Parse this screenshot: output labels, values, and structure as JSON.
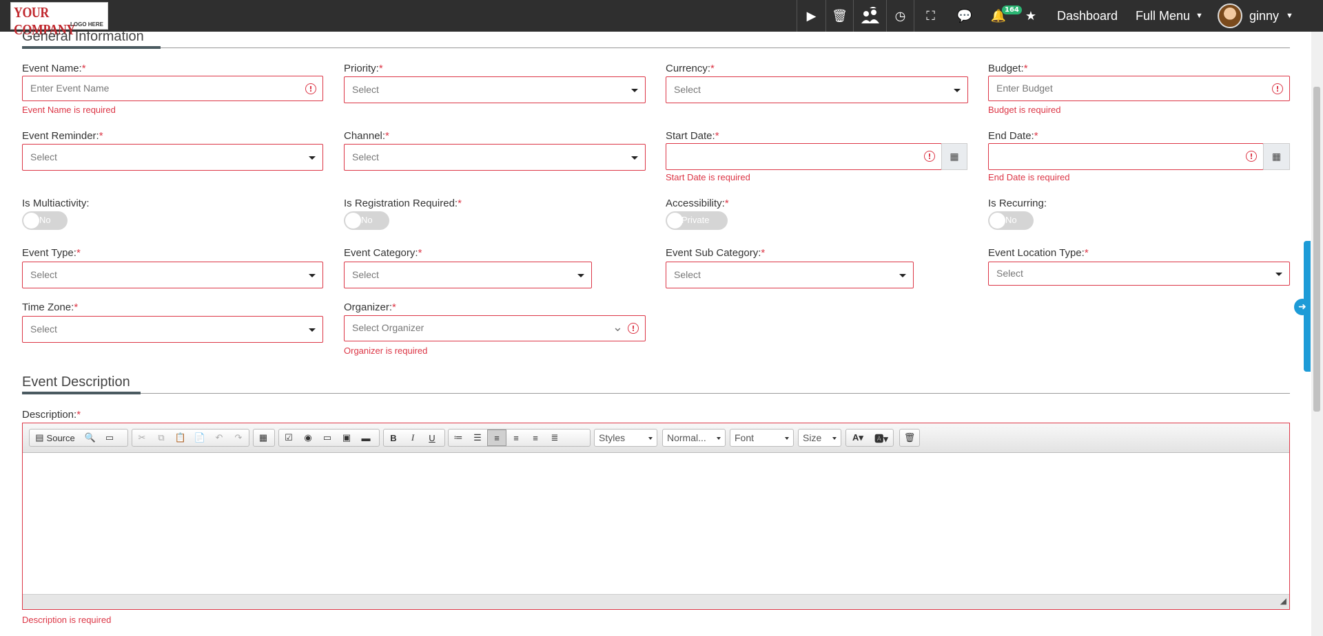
{
  "topbar": {
    "logo_line1": "YOUR COMPANY",
    "logo_line2": "LOGO HERE",
    "notification_count": "164",
    "dashboard_label": "Dashboard",
    "full_menu_label": "Full Menu",
    "user_name": "ginny"
  },
  "general": {
    "section_title": "General Information",
    "event_name": {
      "label": "Event Name:",
      "placeholder": "Enter Event Name",
      "error": "Event Name is required"
    },
    "priority": {
      "label": "Priority:",
      "value": "Select"
    },
    "currency": {
      "label": "Currency:",
      "value": "Select"
    },
    "budget": {
      "label": "Budget:",
      "placeholder": "Enter Budget",
      "error": "Budget is required"
    },
    "event_reminder": {
      "label": "Event Reminder:",
      "value": "Select"
    },
    "channel": {
      "label": "Channel:",
      "value": "Select"
    },
    "start_date": {
      "label": "Start Date:",
      "error": "Start Date is required"
    },
    "end_date": {
      "label": "End Date:",
      "error": "End Date is required"
    },
    "is_multiactivity": {
      "label": "Is Multiactivity:",
      "value": "No"
    },
    "is_registration_required": {
      "label": "Is Registration Required:",
      "value": "No"
    },
    "accessibility": {
      "label": "Accessibility:",
      "value": "Private"
    },
    "is_recurring": {
      "label": "Is Recurring:",
      "value": "No"
    },
    "event_type": {
      "label": "Event Type:",
      "value": "Select"
    },
    "event_category": {
      "label": "Event Category:",
      "value": "Select"
    },
    "event_sub_category": {
      "label": "Event Sub Category:",
      "value": "Select"
    },
    "event_location_type": {
      "label": "Event Location Type:",
      "value": "Select"
    },
    "time_zone": {
      "label": "Time Zone:",
      "value": "Select"
    },
    "organizer": {
      "label": "Organizer:",
      "placeholder": "Select Organizer",
      "error": "Organizer is required"
    }
  },
  "description": {
    "section_title": "Event Description",
    "label": "Description:",
    "error": "Description is required",
    "toolbar": {
      "source": "Source",
      "styles": "Styles",
      "format": "Normal...",
      "font": "Font",
      "size": "Size"
    }
  },
  "required_mark": "*"
}
